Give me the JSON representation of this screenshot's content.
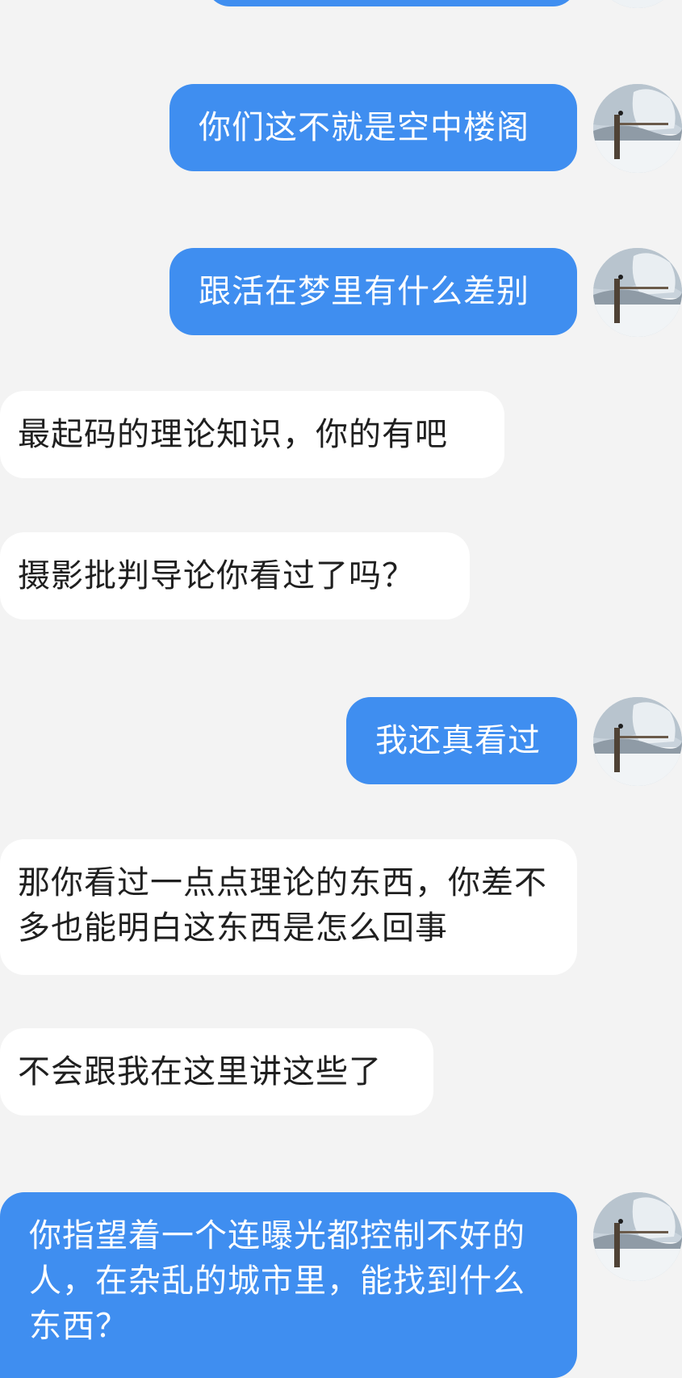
{
  "colors": {
    "background": "#f3f3f3",
    "outgoing_bubble": "#3f8ef0",
    "incoming_bubble": "#ffffff",
    "outgoing_text": "#ffffff",
    "incoming_text": "#1f1f1f"
  },
  "messages": [
    {
      "side": "out",
      "text": "你们这不就是空中楼阁"
    },
    {
      "side": "out",
      "text": "跟活在梦里有什么差别"
    },
    {
      "side": "in",
      "text": "最起码的理论知识，你的有吧"
    },
    {
      "side": "in",
      "text": "摄影批判导论你看过了吗？"
    },
    {
      "side": "out",
      "text": "我还真看过"
    },
    {
      "side": "in",
      "text": "那你看过一点点理论的东西，你差不多也能明白这东西是怎么回事"
    },
    {
      "side": "in",
      "text": "不会跟我在这里讲这些了"
    },
    {
      "side": "out",
      "text": "你指望着一个连曝光都控制不好的人，在杂乱的城市里，能找到什么东西？"
    }
  ],
  "avatar": {
    "icon": "snowy-landscape-avatar"
  }
}
